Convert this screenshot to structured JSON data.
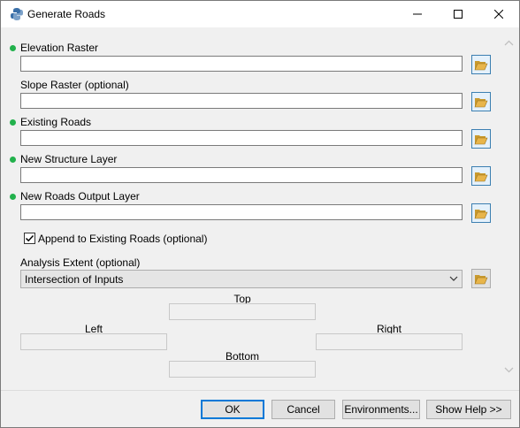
{
  "window": {
    "title": "Generate Roads",
    "controls": [
      "minimize",
      "maximize",
      "close"
    ]
  },
  "parameters": [
    {
      "label": "Elevation Raster",
      "required": true,
      "value": ""
    },
    {
      "label": "Slope Raster (optional)",
      "required": false,
      "value": ""
    },
    {
      "label": "Existing Roads",
      "required": true,
      "value": ""
    },
    {
      "label": "New Structure Layer",
      "required": true,
      "value": ""
    },
    {
      "label": "New Roads Output Layer",
      "required": true,
      "value": ""
    }
  ],
  "append": {
    "label": "Append to Existing Roads (optional)",
    "checked": true
  },
  "extent": {
    "label": "Analysis Extent (optional)",
    "value": "Intersection of Inputs",
    "top_label": "Top",
    "left_label": "Left",
    "right_label": "Right",
    "bottom_label": "Bottom"
  },
  "buttons": {
    "ok": "OK",
    "cancel": "Cancel",
    "environments": "Environments...",
    "show_help": "Show Help >>"
  },
  "colors": {
    "required_dot": "#22b14c",
    "accent": "#0078d7",
    "folder": "#e8b54a"
  },
  "icons": {
    "app": "python-script-icon",
    "browse": "open-folder-icon"
  }
}
